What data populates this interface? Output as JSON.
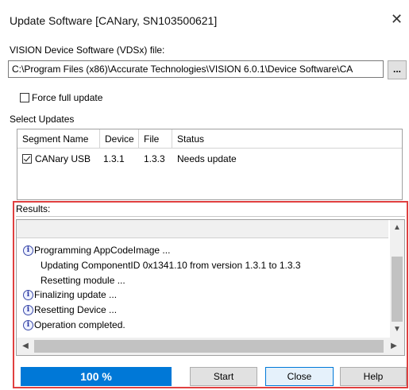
{
  "window": {
    "title": "Update Software [CANary, SN103500621]",
    "close_glyph": "✕"
  },
  "vdsx": {
    "label": "VISION Device Software (VDSx) file:",
    "path": "C:\\Program Files (x86)\\Accurate Technologies\\VISION 6.0.1\\Device Software\\CA",
    "browse_label": "..."
  },
  "force_update": {
    "label": "Force full update",
    "checked": false
  },
  "select_updates": {
    "label": "Select Updates",
    "columns": [
      "Segment Name",
      "Device",
      "File",
      "Status"
    ],
    "rows": [
      {
        "checked": true,
        "segment": "CANary USB",
        "device": "1.3.1",
        "file": "1.3.3",
        "status": "Needs update"
      }
    ]
  },
  "results": {
    "label": "Results:",
    "lines": [
      {
        "icon": true,
        "text": "Programming AppCodeImage ..."
      },
      {
        "icon": false,
        "text": "Updating ComponentID 0x1341.10 from version 1.3.1 to 1.3.3"
      },
      {
        "icon": false,
        "text": "Resetting module ..."
      },
      {
        "icon": true,
        "text": "Finalizing update ..."
      },
      {
        "icon": true,
        "text": "Resetting Device ..."
      },
      {
        "icon": true,
        "text": "Operation completed."
      }
    ]
  },
  "progress": {
    "percent": 100,
    "label": "100 %"
  },
  "buttons": {
    "start": "Start",
    "close": "Close",
    "help": "Help"
  },
  "icons": {
    "info": "info-icon",
    "checkbox": "checkbox-icon",
    "scroll_up": "chevron-up-icon",
    "scroll_down": "chevron-down-icon",
    "scroll_left": "chevron-left-icon",
    "scroll_right": "chevron-right-icon"
  },
  "colors": {
    "accent": "#0078d7",
    "highlight_frame": "#e04040"
  }
}
